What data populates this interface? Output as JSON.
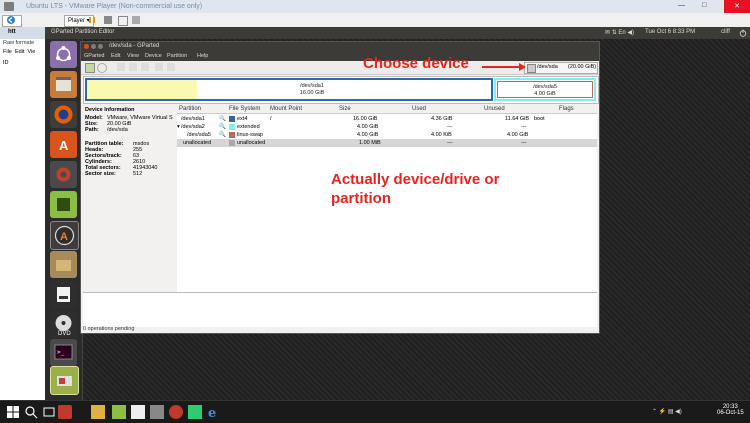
{
  "vmware": {
    "title": "Ubuntu LTS - VMware Player (Non-commercial use only)",
    "player_menu": "Player",
    "controls": [
      "—",
      "□",
      "✕"
    ]
  },
  "host_browser": {
    "tab1": "htt",
    "tab2": "Raw formate",
    "menu_file": "File",
    "menu_edit": "Edit",
    "menu_view": "Vie",
    "item_label": "ID"
  },
  "ubuntu_panel": {
    "app_title": "GParted Partition Editor",
    "clock": "Tue Oct 6 8:33 PM",
    "user": "cliff"
  },
  "gparted": {
    "window_title": "/dev/sda - GParted",
    "menu": [
      "GParted",
      "Edit",
      "View",
      "Device",
      "Partition",
      "Help"
    ],
    "device_selector": "/dev/sda",
    "device_size": "(20.00 GiB)",
    "bar": {
      "seg1_name": "/dev/sda1",
      "seg1_size": "16.00 GiB",
      "seg2_name": "/dev/sda5",
      "seg2_size": "4.00 GiB"
    },
    "device_info": {
      "heading": "Device Information",
      "model_label": "Model:",
      "model": "VMware, VMware Virtual S",
      "size_label": "Size:",
      "size": "20.00 GiB",
      "path_label": "Path:",
      "path": "/dev/sda",
      "pt_label": "Partition table:",
      "pt": "msdos",
      "heads_label": "Heads:",
      "heads": "255",
      "spt_label": "Sectors/track:",
      "spt": "63",
      "cyl_label": "Cylinders:",
      "cyl": "2610",
      "ts_label": "Total sectors:",
      "ts": "41943040",
      "ss_label": "Sector size:",
      "ss": "512"
    },
    "columns": [
      "Partition",
      "File System",
      "Mount Point",
      "Size",
      "Used",
      "Unused",
      "Flags"
    ],
    "rows": [
      {
        "partition": "/dev/sda1",
        "fs": "ext4",
        "fs_color": "#3465a4",
        "mount": "/",
        "size": "16.00 GiB",
        "used": "4.36 GiB",
        "unused": "11.64 GiB",
        "flags": "boot"
      },
      {
        "partition": "/dev/sda2",
        "fs": "extended",
        "fs_color": "#7eeeee",
        "mount": "",
        "size": "4.00 GiB",
        "used": "---",
        "unused": "---",
        "flags": ""
      },
      {
        "partition": "/dev/sda5",
        "fs": "linux-swap",
        "fs_color": "#c1665a",
        "mount": "",
        "size": "4.00 GiB",
        "used": "4.00 KiB",
        "unused": "4.00 GiB",
        "flags": ""
      },
      {
        "partition": "unallocated",
        "fs": "unallocated",
        "fs_color": "#a9a9a9",
        "mount": "",
        "size": "1.00 MiB",
        "used": "---",
        "unused": "---",
        "flags": ""
      }
    ],
    "status": "0 operations pending"
  },
  "annotations": {
    "choose_device": "Choose device",
    "actually_line1": "Actually device/drive or",
    "actually_line2": "partition",
    "color": "#e8241f"
  },
  "taskbar": {
    "time": "20:33",
    "date": "06-Oct-15"
  }
}
